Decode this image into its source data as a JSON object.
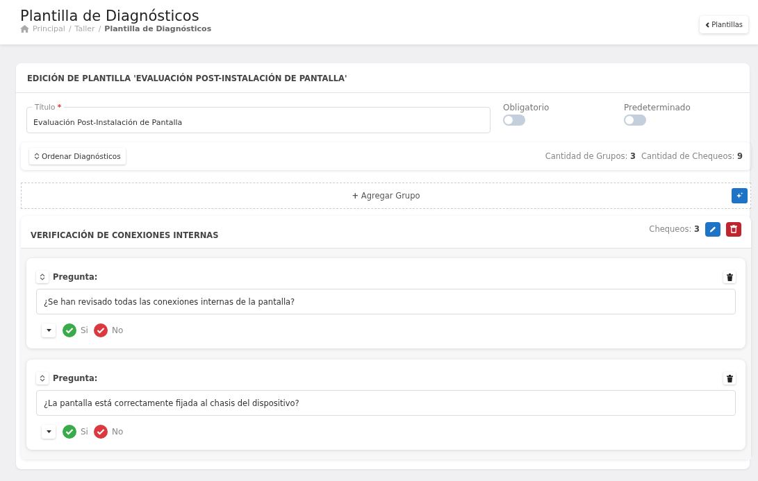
{
  "header": {
    "title": "Plantilla de Diagnósticos",
    "breadcrumb": [
      {
        "label": "Principal",
        "current": false
      },
      {
        "label": "Taller",
        "current": false
      },
      {
        "label": "Plantilla de Diagnósticos",
        "current": true
      }
    ],
    "separator": "/",
    "back_button": "Plantillas"
  },
  "editor": {
    "heading": "EDICIÓN DE PLANTILLA 'EVALUACIÓN POST-INSTALACIÓN DE PANTALLA'",
    "title_field": {
      "label": "Título",
      "required_mark": "*",
      "value": "Evaluación Post-Instalación de Pantalla"
    },
    "toggles": [
      {
        "label": "Obligatorio",
        "on": false
      },
      {
        "label": "Predeterminado",
        "on": false
      }
    ],
    "sort_button": "Ordenar Diagnósticos",
    "counts": [
      {
        "label": "Cantidad de Grupos:",
        "value": "3"
      },
      {
        "label": "Cantidad de Chequeos:",
        "value": "9"
      }
    ],
    "add_group": "Agregar Grupo",
    "add_group_icon": "+",
    "groups": [
      {
        "title": "VERIFICACIÓN DE CONEXIONES INTERNAS",
        "checks_label": "Chequeos:",
        "checks_value": "3",
        "questions": [
          {
            "label": "Pregunta:",
            "value": "¿Se han revisado todas las conexiones internas de la pantalla?",
            "answers": [
              {
                "label": "Si",
                "color": "#3aab4a"
              },
              {
                "label": "No",
                "color": "#d9393f"
              }
            ]
          },
          {
            "label": "Pregunta:",
            "value": "¿La pantalla está correctamente fijada al chasis del dispositivo?",
            "answers": [
              {
                "label": "Si",
                "color": "#3aab4a"
              },
              {
                "label": "No",
                "color": "#d9393f"
              }
            ]
          }
        ]
      }
    ]
  }
}
